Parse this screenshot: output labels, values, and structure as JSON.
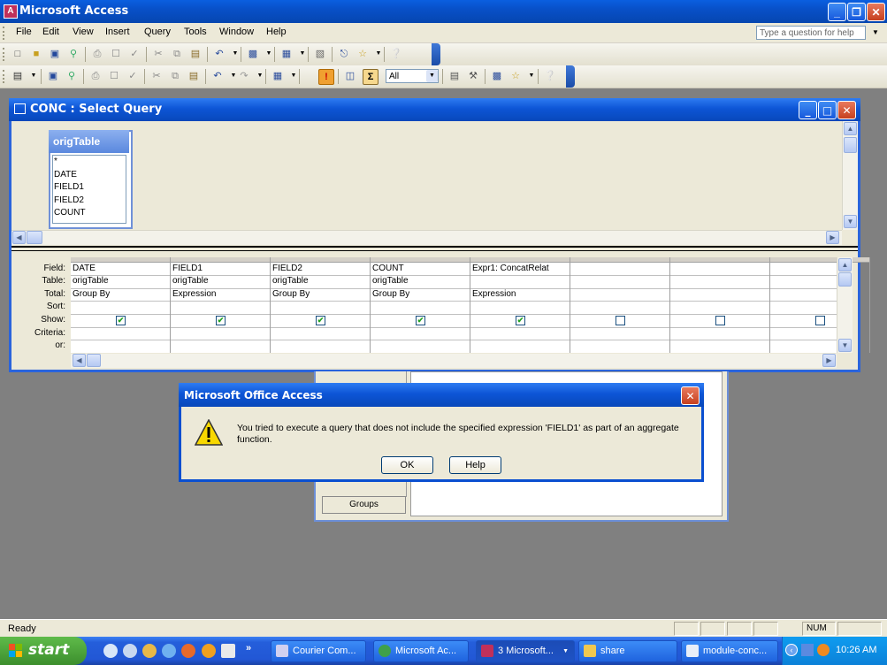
{
  "app": {
    "title": "Microsoft Access"
  },
  "menu": {
    "items": [
      {
        "id": "file",
        "label": "File"
      },
      {
        "id": "edit",
        "label": "Edit"
      },
      {
        "id": "view",
        "label": "View"
      },
      {
        "id": "insert",
        "label": "Insert"
      },
      {
        "id": "query",
        "label": "Query"
      },
      {
        "id": "tools",
        "label": "Tools"
      },
      {
        "id": "window",
        "label": "Window"
      },
      {
        "id": "help",
        "label": "Help"
      }
    ],
    "help_placeholder": "Type a question for help"
  },
  "toolbar2": {
    "top_values": "All"
  },
  "query_window": {
    "title": "CONC : Select Query",
    "table": {
      "name": "origTable",
      "fields": [
        "*",
        "DATE",
        "FIELD1",
        "FIELD2",
        "COUNT"
      ]
    },
    "row_labels": [
      "Field:",
      "Table:",
      "Total:",
      "Sort:",
      "Show:",
      "Criteria:",
      "or:"
    ],
    "columns": [
      {
        "field": "DATE",
        "table": "origTable",
        "total": "Group By",
        "show": true
      },
      {
        "field": "FIELD1",
        "table": "origTable",
        "total": "Expression",
        "show": true
      },
      {
        "field": "FIELD2",
        "table": "origTable",
        "total": "Group By",
        "show": true
      },
      {
        "field": "COUNT",
        "table": "origTable",
        "total": "Group By",
        "show": true
      },
      {
        "field": "Expr1: ConcatRelat",
        "table": "",
        "total": "Expression",
        "show": true
      },
      {
        "field": "",
        "table": "",
        "total": "",
        "show": false
      },
      {
        "field": "",
        "table": "",
        "total": "",
        "show": false
      },
      {
        "field": "",
        "table": "",
        "total": "",
        "show": false
      }
    ]
  },
  "background_dialog": {
    "groups_label": "Groups"
  },
  "message_box": {
    "title": "Microsoft Office Access",
    "text": "You tried to execute a query that does not include the specified expression 'FIELD1' as part of an aggregate function.",
    "ok": "OK",
    "help": "Help"
  },
  "status_bar": {
    "text": "Ready",
    "num": "NUM"
  },
  "taskbar": {
    "start": "start",
    "tasks": [
      {
        "label": "Courier Com...",
        "active": false
      },
      {
        "label": "Microsoft Ac...",
        "active": false
      },
      {
        "label": "3 Microsoft...",
        "active": true
      },
      {
        "label": "share",
        "active": false
      },
      {
        "label": "module-conc...",
        "active": false
      }
    ],
    "clock": "10:26 AM"
  },
  "colors": {
    "accent": "#0a5fe0",
    "titlebar_blue": "#0d55d6",
    "checkmark": "#21a121",
    "taskbar": "#245edb",
    "start_green": "#3c8e2d"
  }
}
